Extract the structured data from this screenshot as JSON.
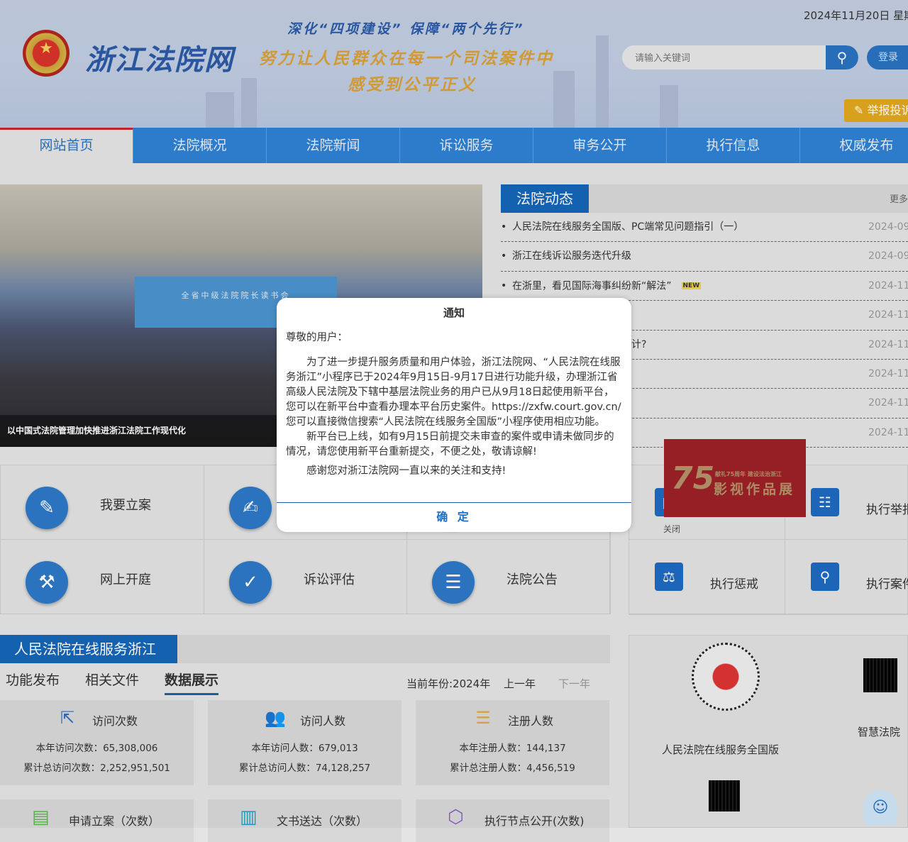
{
  "header": {
    "site_title": "浙江法院网",
    "emblem": "国徽",
    "slogan_line1": "深化“四项建设” 保障“两个先行”",
    "slogan_line2": "努力让人民群众在每一个司法案件中",
    "slogan_line3": "感受到公平正义",
    "date": "2024年11月20日 星期三",
    "search_placeholder": "请输入关键词",
    "login_label": "登录",
    "report_label": "举报投诉"
  },
  "nav": [
    "网站首页",
    "法院概况",
    "法院新闻",
    "诉讼服务",
    "审务公开",
    "执行信息",
    "权威发布"
  ],
  "carousel": {
    "screen_text": "全省中级法院院长读书会",
    "caption": "以中国式法院管理加快推进浙江法院工作现代化"
  },
  "news": {
    "title": "法院动态",
    "more": "更多",
    "new_tag": "NEW",
    "items": [
      {
        "title": "人民法院在线服务全国版、PC端常见问题指引（一）",
        "date": "2024-09",
        "new": false
      },
      {
        "title": "浙江在线诉讼服务迭代升级",
        "date": "2024-09",
        "new": false
      },
      {
        "title": "在浙里，看见国际海事纠纷新“解法”",
        "date": "2024-11",
        "new": true
      },
      {
        "title": "我们亲囡囡一样！”",
        "date": "2024-11",
        "new": true
      },
      {
        "title": "装被抄袭，如何保护原创设计?",
        "date": "2024-11",
        "new": false
      },
      {
        "title": "",
        "date": "2024-11",
        "new": false
      },
      {
        "title": "定分”重在“止争”",
        "date": "2024-11",
        "new": false
      },
      {
        "title": "别及对策",
        "date": "2024-11",
        "new": false
      }
    ]
  },
  "services": [
    "我要立案",
    "",
    "",
    "网上开庭",
    "诉讼评估",
    "法院公告"
  ],
  "exec": [
    "",
    "执行举报",
    "执行惩戒",
    "执行案件查询"
  ],
  "ad": {
    "number": "75",
    "subtitle": "献礼75周年 建设法治浙江",
    "main": "影视作品展",
    "close": "关闭"
  },
  "section": {
    "title": "人民法院在线服务浙江",
    "tabs": [
      "功能发布",
      "相关文件",
      "数据展示"
    ],
    "year_label": "当前年份:2024年",
    "prev": "上一年",
    "next": "下一年",
    "cards": [
      {
        "title": "访问次数",
        "line1": "本年访问次数：65,308,006",
        "line2": "累计总访问次数：2,252,951,501",
        "color": "#2a6fc0"
      },
      {
        "title": "访问人数",
        "line1": "本年访问人数：679,013",
        "line2": "累计总访问人数：74,128,257",
        "color": "#d9676c"
      },
      {
        "title": "注册人数",
        "line1": "本年注册人数：144,137",
        "line2": "累计总注册人数：4,456,519",
        "color": "#e0a84a"
      }
    ],
    "cards2": [
      {
        "title": "申请立案（次数）",
        "color": "#5cb84f"
      },
      {
        "title": "文书送达（次数）",
        "color": "#27a0c0"
      },
      {
        "title": "执行节点公开(次数)",
        "color": "#8a5cc8"
      }
    ]
  },
  "qr": {
    "label1": "人民法院在线服务全国版",
    "label2": "智慧法院"
  },
  "modal": {
    "title": "通知",
    "greeting": "尊敬的用户：",
    "p1": "为了进一步提升服务质量和用户体验，浙江法院网、“人民法院在线服务浙江”小程序已于2024年9月15日-9月17日进行功能升级，办理浙江省高级人民法院及下辖中基层法院业务的用户已从9月18日起使用新平台，您可以在新平台中查看办理本平台历史案件。https://zxfw.court.gov.cn/ 您可以直接微信搜索“人民法院在线服务全国版”小程序使用相应功能。",
    "p2": "新平台已上线，如有9月15日前提交未审查的案件或申请未做同步的情况，请您使用新平台重新提交，不便之处，敬请谅解!",
    "p3": "感谢您对浙江法院网一直以来的关注和支持!",
    "ok": "确 定"
  }
}
